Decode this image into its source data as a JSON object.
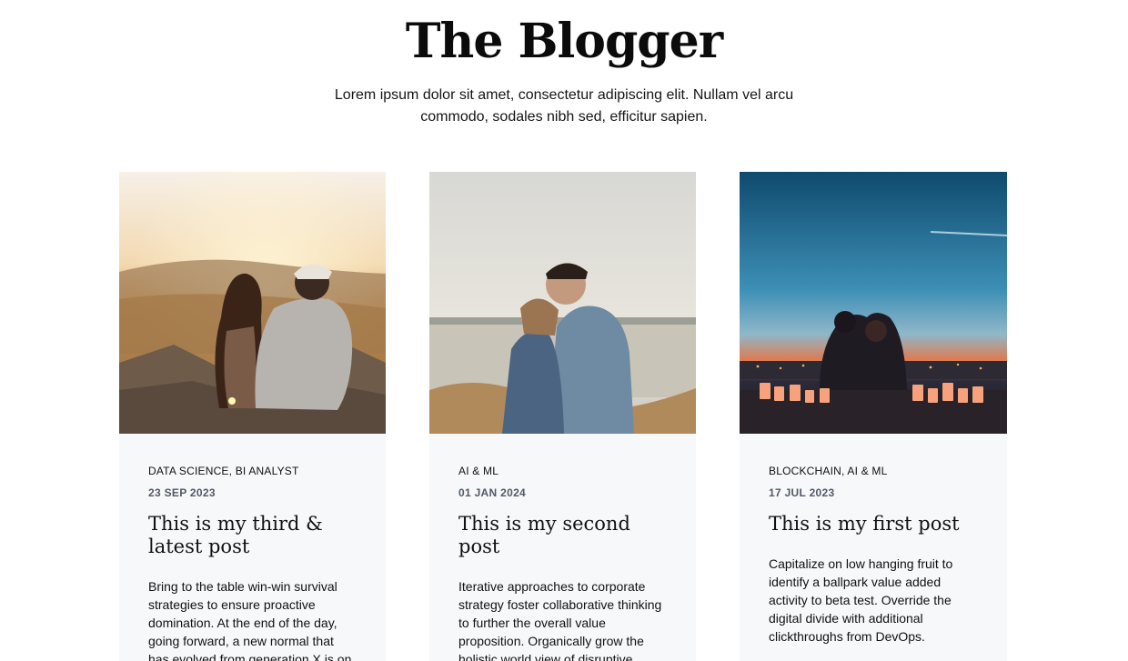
{
  "header": {
    "title": "The Blogger",
    "intro": "Lorem ipsum dolor sit amet, consectetur adipiscing elit. Nullam vel arcu commodo, sodales nibh sed, efficitur sapien."
  },
  "posts": [
    {
      "categories": "DATA SCIENCE, BI ANALYST",
      "date": "23 SEP 2023",
      "title": "This is my third & latest post",
      "excerpt": "Bring to the table win-win survival strategies to ensure proactive domination. At the end of the day, going forward, a new normal that has evolved from generation X is on"
    },
    {
      "categories": "AI & ML",
      "date": "01 JAN 2024",
      "title": "This is my second post",
      "excerpt": "Iterative approaches to corporate strategy foster collaborative thinking to further the overall value proposition. Organically grow the holistic world view of disruptive innovation via workplace diversity"
    },
    {
      "categories": "BLOCKCHAIN, AI & ML",
      "date": "17 JUL 2023",
      "title": "This is my first post",
      "excerpt": "Capitalize on low hanging fruit to identify a ballpark value added activity to beta test. Override the digital divide with additional clickthroughs from DevOps."
    }
  ]
}
